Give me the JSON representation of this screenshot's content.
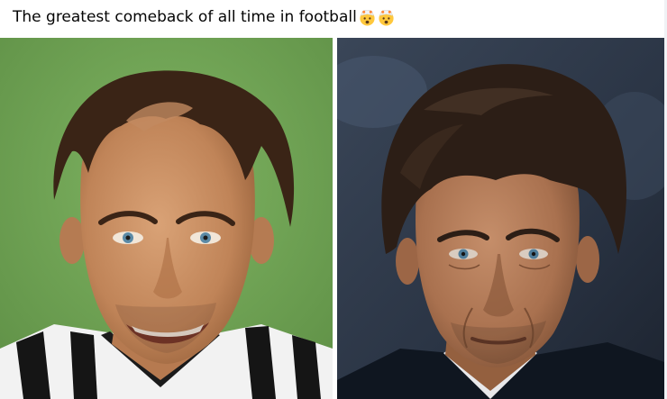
{
  "post": {
    "caption": "The greatest comeback of all time in football",
    "emojis": [
      "exploding-head-emoji",
      "exploding-head-emoji"
    ]
  },
  "colors": {
    "text": "#050505",
    "left_background": "#6fa354",
    "right_background": "#2a3444"
  }
}
